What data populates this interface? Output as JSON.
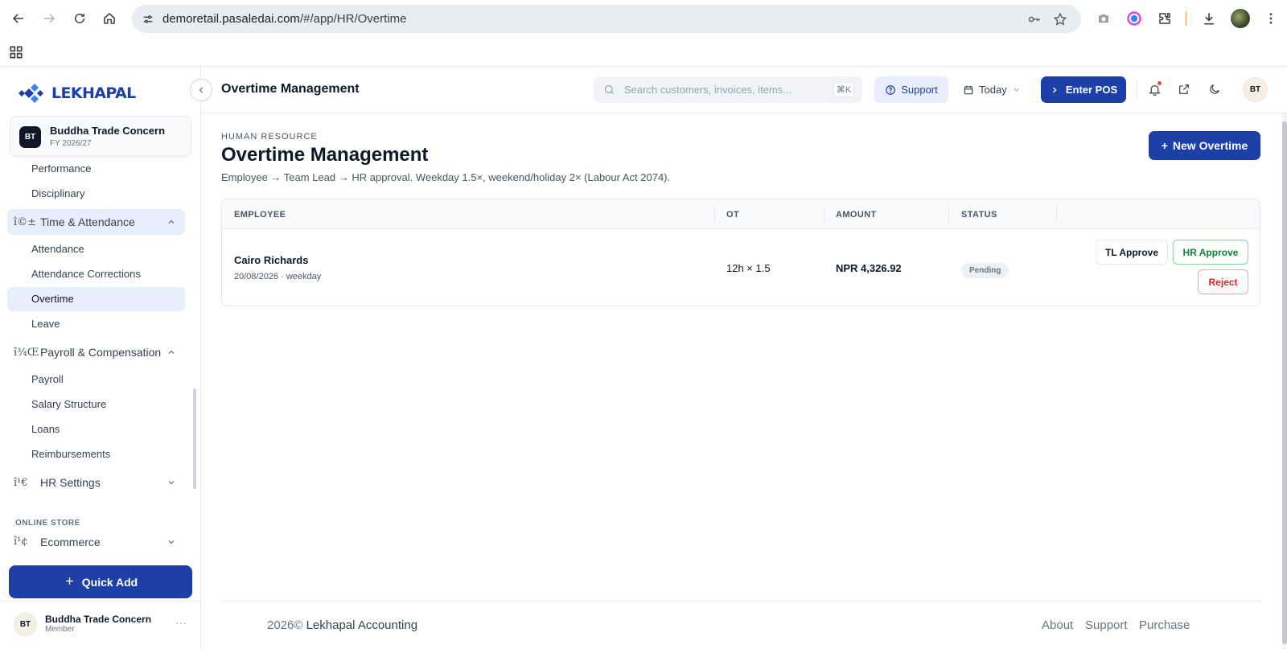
{
  "browser": {
    "url_host": "demoretail.pasaledai.com",
    "url_path": "/#/app/HR/Overtime"
  },
  "sidebar": {
    "brand": "LEKHAPAL",
    "company": {
      "badge": "BT",
      "name": "Buddha Trade Concern",
      "fy": "FY 2026/27"
    },
    "items_top": [
      "Performance",
      "Disciplinary"
    ],
    "groups": {
      "time": {
        "icon": "î©±",
        "label": "Time & Attendance",
        "items": [
          "Attendance",
          "Attendance Corrections",
          "Overtime",
          "Leave"
        ]
      },
      "payroll": {
        "icon": "î¾Œ",
        "label": "Payroll & Compensation",
        "items": [
          "Payroll",
          "Salary Structure",
          "Loans",
          "Reimbursements"
        ]
      },
      "hr_settings": {
        "icon": "î¹€",
        "label": "HR Settings"
      },
      "ecommerce": {
        "icon": "î¹¢",
        "label": "Ecommerce"
      }
    },
    "section_online_store": "ONLINE STORE",
    "quick_add": "Quick Add",
    "user": {
      "badge": "BT",
      "name": "Buddha Trade Concern",
      "role": "Member",
      "more": "···"
    }
  },
  "header": {
    "title": "Overtime Management",
    "search_placeholder": "Search customers, invoices, items...",
    "search_shortcut": "⌘K",
    "support": "Support",
    "date_filter": "Today",
    "enter_pos": "Enter POS",
    "avatar": "BT"
  },
  "page": {
    "kicker": "HUMAN RESOURCE",
    "title": "Overtime Management",
    "description": "Employee → Team Lead → HR approval. Weekday 1.5×, weekend/holiday 2× (Labour Act 2074).",
    "new_button": "New Overtime"
  },
  "table": {
    "headers": [
      "EMPLOYEE",
      "OT",
      "AMOUNT",
      "STATUS"
    ],
    "rows": [
      {
        "employee": "Cairo Richards",
        "sub": "20/08/2026 · weekday",
        "ot": "12h × 1.5",
        "amount": "NPR 4,326.92",
        "status": "Pending",
        "actions": [
          "TL Approve",
          "HR Approve",
          "Reject"
        ]
      }
    ]
  },
  "footer": {
    "year": "2026©",
    "company": "Lekhapal Accounting",
    "links": [
      "About",
      "Support",
      "Purchase"
    ]
  },
  "colors": {
    "primary": "#1d3fa8",
    "active_bg": "#e8eefb",
    "approve_green": "#15803d",
    "reject_red": "#dc2626"
  }
}
